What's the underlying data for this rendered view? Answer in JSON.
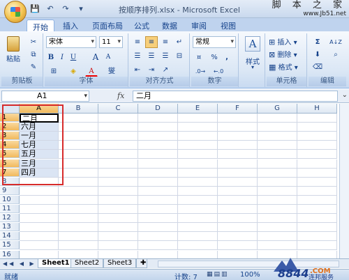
{
  "window": {
    "title": "按顺序排列.xlsx - Microsoft Excel",
    "watermark_top": "脚 本 之 家",
    "watermark_url": "www.Jb51.net"
  },
  "quick_access": {
    "save": "💾",
    "undo": "↶",
    "redo": "↷",
    "customize": "▾"
  },
  "tabs": [
    "开始",
    "插入",
    "页面布局",
    "公式",
    "数据",
    "审阅",
    "视图"
  ],
  "ribbon": {
    "clipboard": {
      "paste_label": "粘贴",
      "group_label": "剪贴板"
    },
    "font": {
      "font_name": "宋体",
      "font_size": "11",
      "bold": "B",
      "italic": "I",
      "underline": "U",
      "grow": "A",
      "shrink": "A",
      "font_color": "A",
      "phonetic": "燮",
      "group_label": "字体"
    },
    "alignment": {
      "group_label": "对齐方式"
    },
    "number": {
      "format": "常规",
      "percent": "%",
      "comma": ",",
      "group_label": "数字"
    },
    "styles": {
      "label": "样式"
    },
    "cells": {
      "insert": "插入",
      "delete": "删除",
      "format": "格式",
      "group_label": "单元格"
    },
    "editing": {
      "sum": "Σ",
      "sort": "A↓Z",
      "group_label": "编辑"
    }
  },
  "formula_bar": {
    "name_box": "A1",
    "fx": "fx",
    "value": "二月"
  },
  "columns": [
    "A",
    "B",
    "C",
    "D",
    "E",
    "F",
    "G",
    "H"
  ],
  "rows": [
    "1",
    "2",
    "3",
    "4",
    "5",
    "6",
    "7",
    "8",
    "9",
    "10",
    "11",
    "12",
    "13",
    "14",
    "15",
    "16"
  ],
  "cells_col_a": [
    "二月",
    "六月",
    "一月",
    "七月",
    "五月",
    "三月",
    "四月"
  ],
  "sheets": [
    "Sheet1",
    "Sheet2",
    "Sheet3"
  ],
  "status": {
    "ready": "就绪",
    "count": "计数: 7",
    "zoom": "100%"
  },
  "brand_logo": {
    "text": "8844",
    "sub": "连邦服务",
    "dotcom": ".COM"
  },
  "colors": {
    "selection_border": "#d72b2b",
    "accent": "#15428b"
  }
}
